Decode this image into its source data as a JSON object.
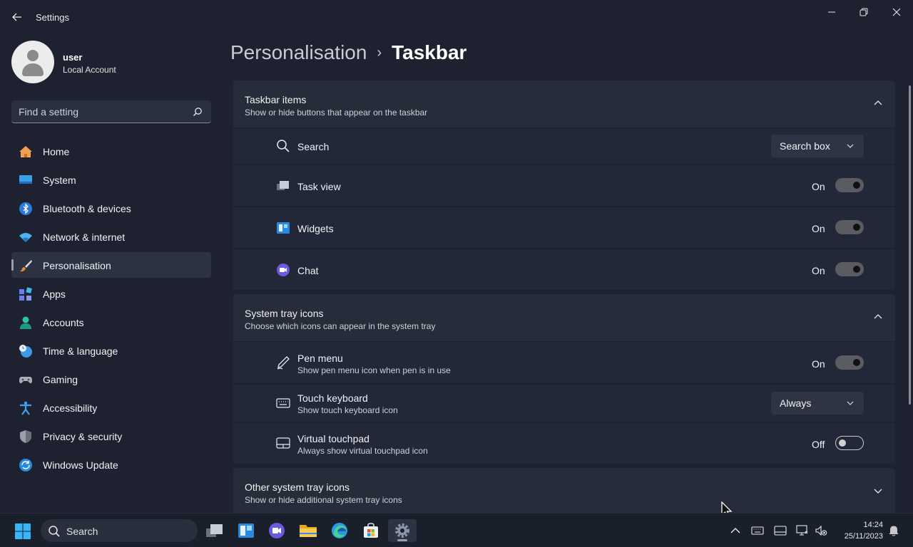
{
  "window": {
    "app_title": "Settings"
  },
  "profile": {
    "name": "user",
    "account_type": "Local Account"
  },
  "search": {
    "placeholder": "Find a setting"
  },
  "nav": {
    "items": [
      {
        "label": "Home",
        "icon": "home-icon"
      },
      {
        "label": "System",
        "icon": "monitor-icon"
      },
      {
        "label": "Bluetooth & devices",
        "icon": "bluetooth-icon"
      },
      {
        "label": "Network & internet",
        "icon": "wifi-icon"
      },
      {
        "label": "Personalisation",
        "icon": "paintbrush-icon",
        "active": true
      },
      {
        "label": "Apps",
        "icon": "apps-icon"
      },
      {
        "label": "Accounts",
        "icon": "person-icon"
      },
      {
        "label": "Time & language",
        "icon": "clock-globe-icon"
      },
      {
        "label": "Gaming",
        "icon": "gamepad-icon"
      },
      {
        "label": "Accessibility",
        "icon": "accessibility-icon"
      },
      {
        "label": "Privacy & security",
        "icon": "shield-icon"
      },
      {
        "label": "Windows Update",
        "icon": "update-icon"
      }
    ]
  },
  "breadcrumb": {
    "parent": "Personalisation",
    "separator": "›",
    "current": "Taskbar"
  },
  "taskbar_items": {
    "title": "Taskbar items",
    "subtitle": "Show or hide buttons that appear on the taskbar",
    "search": {
      "label": "Search",
      "value": "Search box"
    },
    "task_view": {
      "label": "Task view",
      "state": "On"
    },
    "widgets": {
      "label": "Widgets",
      "state": "On"
    },
    "chat": {
      "label": "Chat",
      "state": "On"
    }
  },
  "system_tray": {
    "title": "System tray icons",
    "subtitle": "Choose which icons can appear in the system tray",
    "pen_menu": {
      "label": "Pen menu",
      "description": "Show pen menu icon when pen is in use",
      "state": "On"
    },
    "touch_keyboard": {
      "label": "Touch keyboard",
      "description": "Show touch keyboard icon",
      "value": "Always"
    },
    "virtual_touchpad": {
      "label": "Virtual touchpad",
      "description": "Always show virtual touchpad icon",
      "state": "Off"
    }
  },
  "other_tray": {
    "title": "Other system tray icons",
    "subtitle": "Show or hide additional system tray icons"
  },
  "taskbar": {
    "search_label": "Search",
    "time": "14:24",
    "date": "25/11/2023"
  },
  "colors": {
    "background": "#1e2230",
    "card": "#272c3a",
    "row": "#232838",
    "accent": "#4cc2ff"
  }
}
